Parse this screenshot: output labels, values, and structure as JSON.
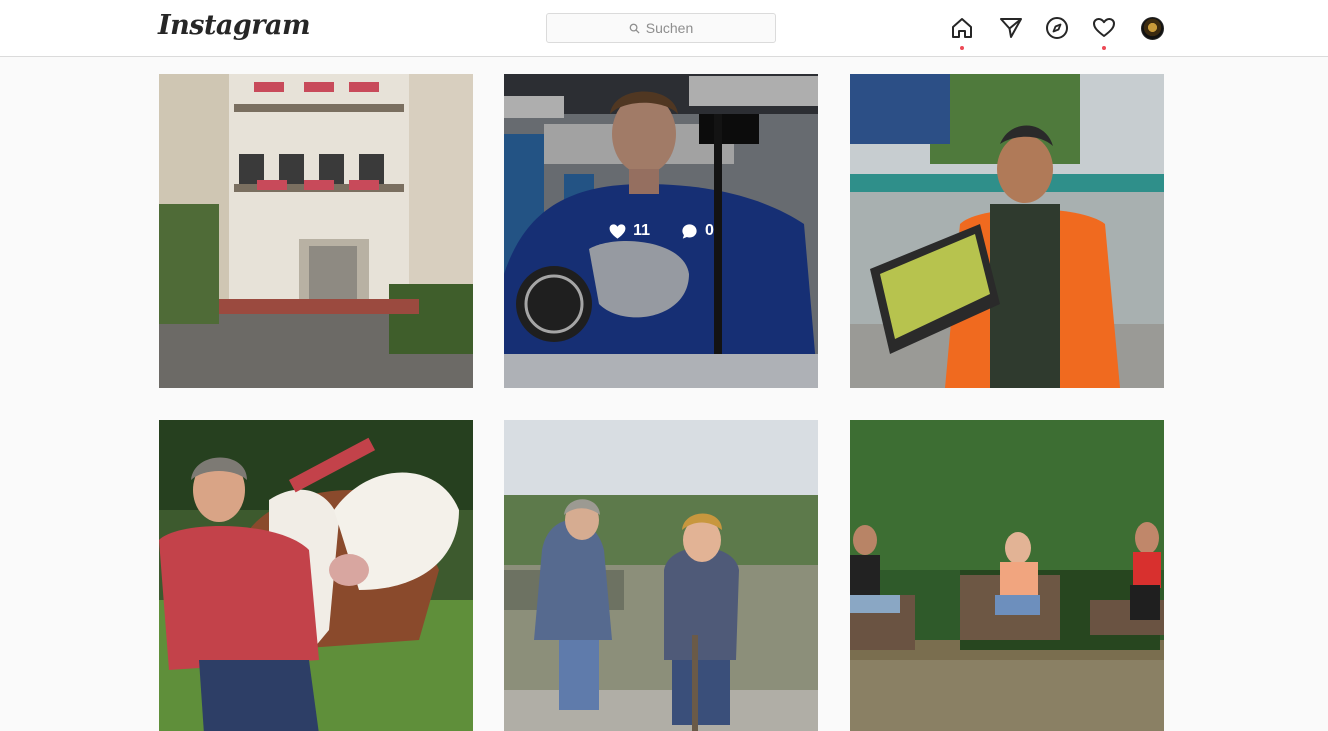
{
  "header": {
    "logo": "Instagram",
    "search_placeholder": "Suchen",
    "icons": [
      "home-icon",
      "direct-icon",
      "explore-icon",
      "activity-heart-icon",
      "profile-avatar"
    ],
    "accent_dot": "#ed4956"
  },
  "posts": [
    {
      "name": "building-balconies"
    },
    {
      "name": "hockey-player",
      "hovered": true,
      "likes": "11",
      "comments": "0"
    },
    {
      "name": "market-vendor-grapes"
    },
    {
      "name": "woman-with-cows"
    },
    {
      "name": "children-on-hill"
    },
    {
      "name": "people-on-benches"
    }
  ]
}
